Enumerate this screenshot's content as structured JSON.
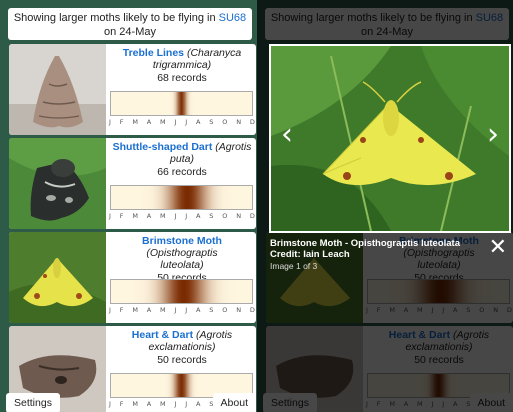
{
  "header": {
    "prefix": "Showing larger moths likely to be flying in ",
    "grid_ref": "SU68",
    "suffix": " on 24-May"
  },
  "months": [
    "J",
    "F",
    "M",
    "A",
    "M",
    "J",
    "J",
    "A",
    "S",
    "O",
    "N",
    "D"
  ],
  "species": [
    {
      "common": "Treble Lines",
      "scientific_a": "(Charanyca",
      "scientific_b": "trigrammica)",
      "records": "68 records",
      "flight_peak_month": 6.0,
      "flight_spread": 0.4
    },
    {
      "common": "Shuttle-shaped Dart",
      "scientific_a": "(Agrotis",
      "scientific_b": "puta)",
      "records": "66 records",
      "flight_peak_month": 6.5,
      "flight_spread": 1.6
    },
    {
      "common": "Brimstone Moth",
      "scientific_a": "(Opisthograptis",
      "scientific_b": "luteolata)",
      "records": "50 records",
      "flight_peak_month": 6.2,
      "flight_spread": 1.8
    },
    {
      "common": "Heart & Dart",
      "scientific_a": "(Agrotis",
      "scientific_b": "exclamationis)",
      "records": "50 records",
      "flight_peak_month": 6.0,
      "flight_spread": 0.6
    }
  ],
  "buttons": {
    "settings": "Settings",
    "about": "About"
  },
  "lightbox": {
    "title": "Brimstone Moth - Opisthograptis luteolata",
    "credit": "Credit: Iain Leach",
    "counter": "Image 1 of 3",
    "prev_icon": "chevron-left-icon",
    "next_icon": "chevron-right-icon",
    "close_icon": "close-icon"
  },
  "colors": {
    "link": "#1a6fd1",
    "background": "#2e5a48",
    "flight_strong": "#7a2a00",
    "flight_weak": "#fff6e0"
  }
}
